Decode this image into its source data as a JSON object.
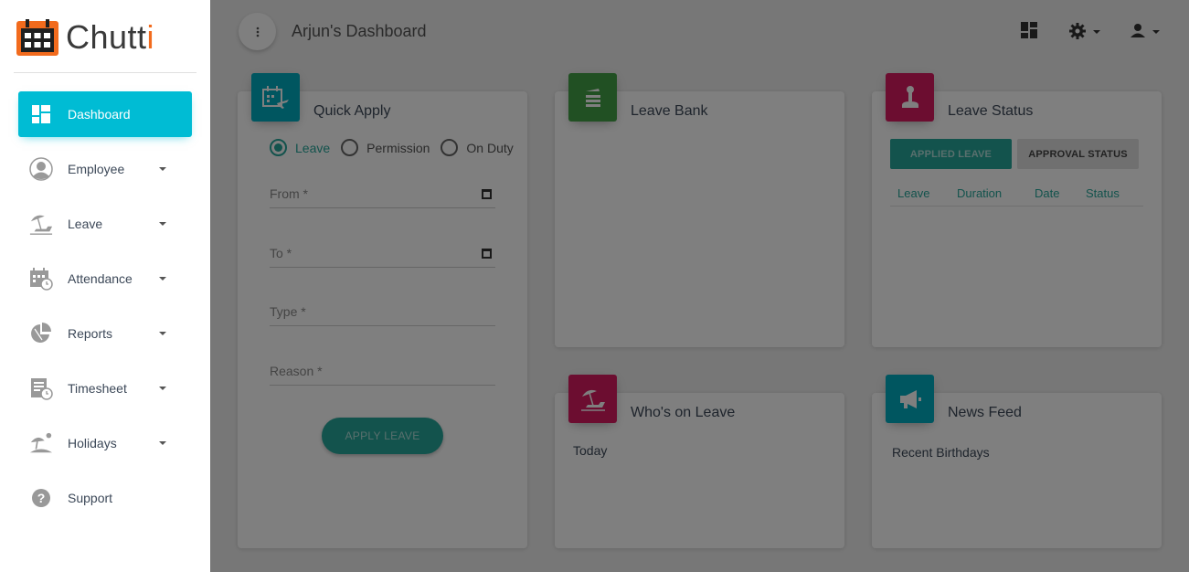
{
  "brand": {
    "name_main": "Chutt",
    "name_accent": "i",
    "colors": {
      "orange": "#f26b1d",
      "dark": "#1f1f1f"
    }
  },
  "sidebar": {
    "items": [
      {
        "label": "Dashboard",
        "icon": "dashboard-icon",
        "active": true
      },
      {
        "label": "Employee",
        "icon": "user-circle-icon",
        "caret": true
      },
      {
        "label": "Leave",
        "icon": "beach-umbrella-icon",
        "caret": true
      },
      {
        "label": "Attendance",
        "icon": "calendar-clock-icon",
        "caret": true
      },
      {
        "label": "Reports",
        "icon": "pie-chart-icon",
        "caret": true
      },
      {
        "label": "Timesheet",
        "icon": "sheet-clock-icon",
        "caret": true
      },
      {
        "label": "Holidays",
        "icon": "island-icon",
        "caret": true
      },
      {
        "label": "Support",
        "icon": "help-icon"
      }
    ],
    "active_color": "#00bcd4"
  },
  "header": {
    "title": "Arjun's Dashboard",
    "icons": [
      "more-vert-icon",
      "dashboard-grid-icon",
      "gear-icon",
      "person-icon"
    ]
  },
  "quick_apply": {
    "title": "Quick Apply",
    "icon_color": "#00acc1",
    "radios": [
      {
        "label": "Leave",
        "checked": true
      },
      {
        "label": "Permission",
        "checked": false
      },
      {
        "label": "On Duty",
        "checked": false
      }
    ],
    "fields": {
      "from": "From *",
      "to": "To *",
      "type": "Type *",
      "reason": "Reason *"
    },
    "button": "APPLY LEAVE",
    "accent": "#26a69a"
  },
  "leave_bank": {
    "title": "Leave Bank",
    "icon_color": "#43a047"
  },
  "leave_status": {
    "title": "Leave Status",
    "icon_color": "#d81b60",
    "tabs": [
      "APPLIED LEAVE",
      "APPROVAL STATUS"
    ],
    "columns": [
      "Leave",
      "Duration",
      "Date",
      "Status"
    ]
  },
  "whos_on_leave": {
    "title": "Who's on Leave",
    "icon_color": "#d81b60",
    "subtitle": "Today"
  },
  "news_feed": {
    "title": "News Feed",
    "icon_color": "#00acc1",
    "subtitle": "Recent Birthdays"
  }
}
